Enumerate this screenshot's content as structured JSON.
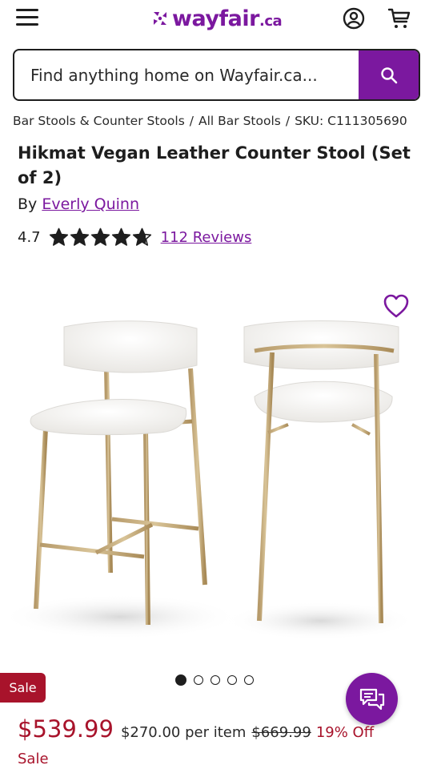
{
  "header": {
    "logo_text": "wayfair",
    "logo_tld": ".ca",
    "menu_icon": "hamburger-menu-icon",
    "account_icon": "user-account-icon",
    "cart_icon": "shopping-cart-icon"
  },
  "search": {
    "placeholder": "Find anything home on Wayfair.ca...",
    "button_icon": "search-icon"
  },
  "breadcrumb": {
    "items": [
      "Bar Stools & Counter Stools",
      "All Bar Stools"
    ],
    "sku": "SKU: C111305690",
    "separator": "/"
  },
  "product": {
    "title": "Hikmat Vegan Leather Counter Stool (Set of 2)",
    "by_label": "By",
    "brand": "Everly Quinn",
    "rating": "4.7",
    "rating_value": 4.7,
    "stars_max": 5,
    "reviews": "112 Reviews"
  },
  "gallery": {
    "image_count": 5,
    "active_index": 0,
    "wishlist_icon": "heart-icon"
  },
  "badge": {
    "sale": "Sale"
  },
  "pricing": {
    "price": "$539.99",
    "per_item": "$270.00 per item",
    "original": "$669.99",
    "discount": "19% Off",
    "sale_label": "Sale"
  },
  "chat": {
    "icon": "chat-bubbles-icon"
  },
  "colors": {
    "brand_purple": "#7b189f",
    "sale_red": "#a8132b",
    "text": "#1e1e1e"
  }
}
